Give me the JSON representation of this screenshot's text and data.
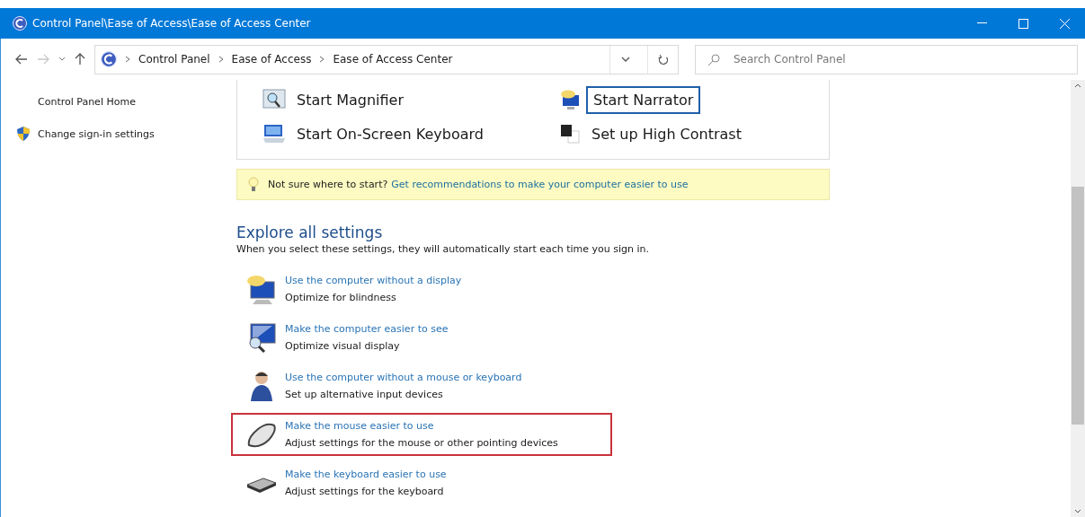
{
  "window": {
    "title": "Control Panel\\Ease of Access\\Ease of Access Center"
  },
  "address_bar": {
    "breadcrumbs": [
      "Control Panel",
      "Ease of Access",
      "Ease of Access Center"
    ]
  },
  "search": {
    "placeholder": "Search Control Panel"
  },
  "sidebar": {
    "items": [
      {
        "label": "Control Panel Home",
        "kind": "plain"
      },
      {
        "label": "Change sign-in settings",
        "kind": "shield"
      }
    ]
  },
  "quick_tools": [
    {
      "label": "Start Magnifier",
      "kind": "magnifier",
      "focused": false
    },
    {
      "label": "Start Narrator",
      "kind": "narrator",
      "focused": true
    },
    {
      "label": "Start On-Screen Keyboard",
      "kind": "keyboard",
      "focused": false
    },
    {
      "label": "Set up High Contrast",
      "kind": "contrast",
      "focused": false
    }
  ],
  "tip": {
    "text": "Not sure where to start?",
    "link": "Get recommendations to make your computer easier to use"
  },
  "explore": {
    "heading": "Explore all settings",
    "subtitle": "When you select these settings, they will automatically start each time you sign in.",
    "items": [
      {
        "link": "Use the computer without a display",
        "description": "Optimize for blindness",
        "kind": "display",
        "highlighted": false
      },
      {
        "link": "Make the computer easier to see",
        "description": "Optimize visual display",
        "kind": "see",
        "highlighted": false
      },
      {
        "link": "Use the computer without a mouse or keyboard",
        "description": "Set up alternative input devices",
        "kind": "person",
        "highlighted": false
      },
      {
        "link": "Make the mouse easier to use",
        "description": "Adjust settings for the mouse or other pointing devices",
        "kind": "mouse",
        "highlighted": true
      },
      {
        "link": "Make the keyboard easier to use",
        "description": "Adjust settings for the keyboard",
        "kind": "keyboard",
        "highlighted": false
      }
    ]
  }
}
